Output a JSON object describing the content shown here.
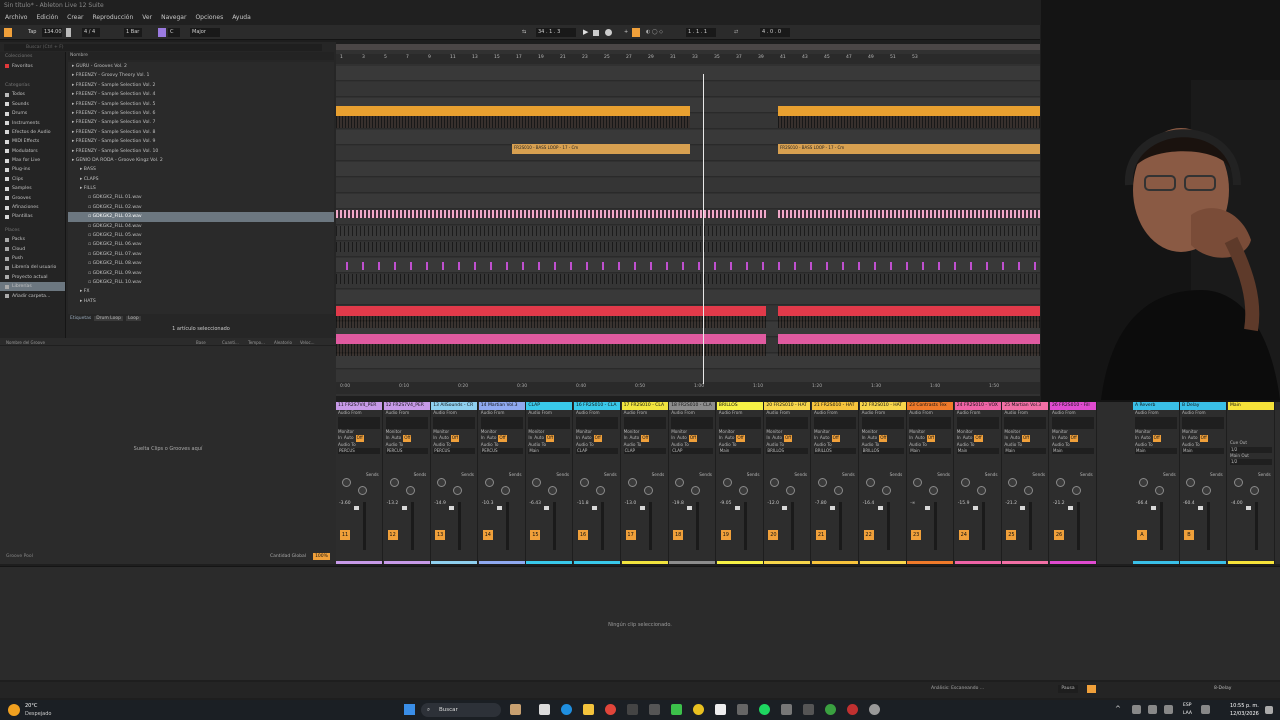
{
  "window": {
    "title": "Sin título* - Ableton Live 12 Suite"
  },
  "menu": [
    "Archivo",
    "Edición",
    "Crear",
    "Reproducción",
    "Ver",
    "Navegar",
    "Opciones",
    "Ayuda"
  ],
  "transport": {
    "tap": "Tap",
    "tempo": "134.00",
    "signature": "4 / 4",
    "quantize": "1 Bar",
    "key": "C",
    "scale": "Major",
    "position": "34 . 1 . 3",
    "loop_start": "1 . 1 . 1",
    "loop_length": "4 . 0 . 0"
  },
  "browser": {
    "search_placeholder": "Buscar (Ctrl + F)",
    "collections_title": "Colecciones",
    "favorite": "Favoritos",
    "categories_title": "Categorías",
    "categories": [
      "Todos",
      "Sounds",
      "Drums",
      "Instruments",
      "Efectos de Audio",
      "MIDI Effects",
      "Modulators",
      "Max for Live",
      "Plug-ins",
      "Clips",
      "Samples",
      "Grooves",
      "Afinaciones",
      "Plantillas"
    ],
    "places_title": "Places",
    "places": [
      "Packs",
      "Cloud",
      "Push",
      "Librería del usuario",
      "Proyecto actual",
      "Librerías",
      "Añadir carpeta..."
    ],
    "column_name": "Nombre",
    "items": [
      {
        "label": "GURU - Grooves Vol. 2",
        "indent": 0,
        "selected": false
      },
      {
        "label": "FREENZY - Groovy Theory Vol. 1",
        "indent": 0,
        "selected": false
      },
      {
        "label": "FREENZY - Sample Selection Vol. 2",
        "indent": 0,
        "selected": false
      },
      {
        "label": "FREENZY - Sample Selection Vol. 4",
        "indent": 0,
        "selected": false
      },
      {
        "label": "FREENZY - Sample Selection Vol. 5",
        "indent": 0,
        "selected": false
      },
      {
        "label": "FREENZY - Sample Selection Vol. 6",
        "indent": 0,
        "selected": false
      },
      {
        "label": "FREENZY - Sample Selection Vol. 7",
        "indent": 0,
        "selected": false
      },
      {
        "label": "FREENZY - Sample Selection Vol. 8",
        "indent": 0,
        "selected": false
      },
      {
        "label": "FREENZY - Sample Selection Vol. 9",
        "indent": 0,
        "selected": false
      },
      {
        "label": "FREENZY - Sample Selection Vol. 10",
        "indent": 0,
        "selected": false
      },
      {
        "label": "GENIO DA RODA - Groove Kingz Vol. 2",
        "indent": 0,
        "selected": false
      },
      {
        "label": "BASS",
        "indent": 1,
        "selected": false
      },
      {
        "label": "CLAPS",
        "indent": 1,
        "selected": false
      },
      {
        "label": "FILLS",
        "indent": 1,
        "selected": false
      },
      {
        "label": "GDKGK2_FILL 01.wav",
        "indent": 2,
        "selected": false
      },
      {
        "label": "GDKGK2_FILL 02.wav",
        "indent": 2,
        "selected": false
      },
      {
        "label": "GDKGK2_FILL 03.wav",
        "indent": 2,
        "selected": true
      },
      {
        "label": "GDKGK2_FILL 04.wav",
        "indent": 2,
        "selected": false
      },
      {
        "label": "GDKGK2_FILL 05.wav",
        "indent": 2,
        "selected": false
      },
      {
        "label": "GDKGK2_FILL 06.wav",
        "indent": 2,
        "selected": false
      },
      {
        "label": "GDKGK2_FILL 07.wav",
        "indent": 2,
        "selected": false
      },
      {
        "label": "GDKGK2_FILL 08.wav",
        "indent": 2,
        "selected": false
      },
      {
        "label": "GDKGK2_FILL 09.wav",
        "indent": 2,
        "selected": false
      },
      {
        "label": "GDKGK2_FILL 10.wav",
        "indent": 2,
        "selected": false
      },
      {
        "label": "FX",
        "indent": 1,
        "selected": false
      },
      {
        "label": "HATS",
        "indent": 1,
        "selected": false
      }
    ],
    "tags_label": "Etiquetas",
    "tags": [
      "Drum Loop",
      "Loop"
    ],
    "selection_status": "1 artículo seleccionado"
  },
  "groove_pool": {
    "columns": [
      "Nombre del Groove",
      "Base",
      "Cuanti...",
      "Tempo...",
      "Aleatorio",
      "Veloc..."
    ],
    "drop_hint": "Suelta Clips o Grooves aquí",
    "footer_left": "Groove Pool",
    "footer_global": "Cantidad Global",
    "global_amount": "100%"
  },
  "arrangement": {
    "bar_numbers": [
      "1",
      "3",
      "5",
      "7",
      "9",
      "11",
      "13",
      "15",
      "17",
      "19",
      "21",
      "23",
      "25",
      "27",
      "29",
      "31",
      "33",
      "35",
      "37",
      "39",
      "41",
      "43",
      "45",
      "47",
      "49",
      "51",
      "53"
    ],
    "time_labels": [
      "0:00",
      "0:10",
      "0:20",
      "0:30",
      "0:40",
      "0:50",
      "1:00",
      "1:10",
      "1:20",
      "1:30",
      "1:40",
      "1:50"
    ],
    "bass_clip_label": "FR2S010 - BASS LOOP - 17 - Cm"
  },
  "mixer": {
    "audio_from": "Audio From",
    "audio_to": "Audio To",
    "monitor": "Monitor",
    "in": "In",
    "auto": "Auto",
    "off": "Off",
    "sends": "Sends",
    "tracks": [
      {
        "name": "11 FR2S7V4_PER",
        "color": "#c79ae8",
        "num": "11",
        "vol": "-3.60",
        "out": "PERCUS"
      },
      {
        "name": "12 FR2S7V4_PER",
        "color": "#c79ae8",
        "num": "12",
        "vol": "-13.2",
        "out": "PERCUS"
      },
      {
        "name": "13 AllSounds - CR",
        "color": "#8fd0ef",
        "num": "13",
        "vol": "-14.9",
        "out": "PERCUS"
      },
      {
        "name": "14 Martian Vol.3",
        "color": "#8fa9f0",
        "num": "14",
        "vol": "-10.3",
        "out": "PERCUS"
      },
      {
        "name": "CLAP",
        "color": "#39c9ea",
        "num": "15",
        "vol": "-6.43",
        "out": "Main"
      },
      {
        "name": "16 FR2S010 - CLA",
        "color": "#39c9ea",
        "num": "16",
        "vol": "-11.8",
        "out": "CLAP"
      },
      {
        "name": "17 FR2S010 - CLA",
        "color": "#f2e43e",
        "num": "17",
        "vol": "-13.0",
        "out": "CLAP"
      },
      {
        "name": "18 FR2S010 - CLA",
        "color": "#8d8d8d",
        "num": "18",
        "vol": "-19.8",
        "out": "CLAP"
      },
      {
        "name": "BRILLOS",
        "color": "#f7f246",
        "num": "19",
        "vol": "-9.05",
        "out": "Main"
      },
      {
        "name": "20 FR2S010 - HAT",
        "color": "#f7d64b",
        "num": "20",
        "vol": "-12.0",
        "out": "BRILLOS"
      },
      {
        "name": "21 FR2S010 - HAT",
        "color": "#f7c33c",
        "num": "21",
        "vol": "-7.80",
        "out": "BRILLOS"
      },
      {
        "name": "22 FR2S010 - HAT",
        "color": "#f7d64b",
        "num": "22",
        "vol": "-16.4",
        "out": "BRILLOS"
      },
      {
        "name": "23 Contrasts Tex",
        "color": "#f07a2a",
        "num": "23",
        "vol": "-∞",
        "out": "Main"
      },
      {
        "name": "24 FR2S010 - VOX",
        "color": "#ef63a6",
        "num": "24",
        "vol": "-15.9",
        "out": "Main"
      },
      {
        "name": "25 Martian Vol.3",
        "color": "#f26fa5",
        "num": "25",
        "vol": "-21.2",
        "out": "Main"
      },
      {
        "name": "26 FR2S010 - Fill",
        "color": "#e04bd0",
        "num": "26",
        "vol": "-21.2",
        "out": "Main"
      }
    ],
    "returns": [
      {
        "name": "A Reverb",
        "color": "#3ac0e8",
        "num": "A",
        "vol": "-66.4",
        "out": "Main"
      },
      {
        "name": "B Delay",
        "color": "#3ac0e8",
        "num": "B",
        "vol": "-60.4",
        "out": "Main"
      }
    ],
    "master": {
      "name": "Main",
      "color": "#f7e33a",
      "vol": "-4.00",
      "cue_out": "Cue Out",
      "cue_val": "1/2",
      "main_out": "Main Out",
      "main_val": "1/2"
    }
  },
  "detail": {
    "empty_message": "Ningún clip seleccionado."
  },
  "status": {
    "analysis": "Análisis: Escaneando ...",
    "pause": "Pausa",
    "device": "8-Delay"
  },
  "taskbar": {
    "weather_temp": "20°C",
    "weather_desc": "Despejado",
    "search": "Buscar",
    "lang": "ESP",
    "lang2": "LAA",
    "time": "10:55 p. m.",
    "date": "12/03/2026"
  }
}
